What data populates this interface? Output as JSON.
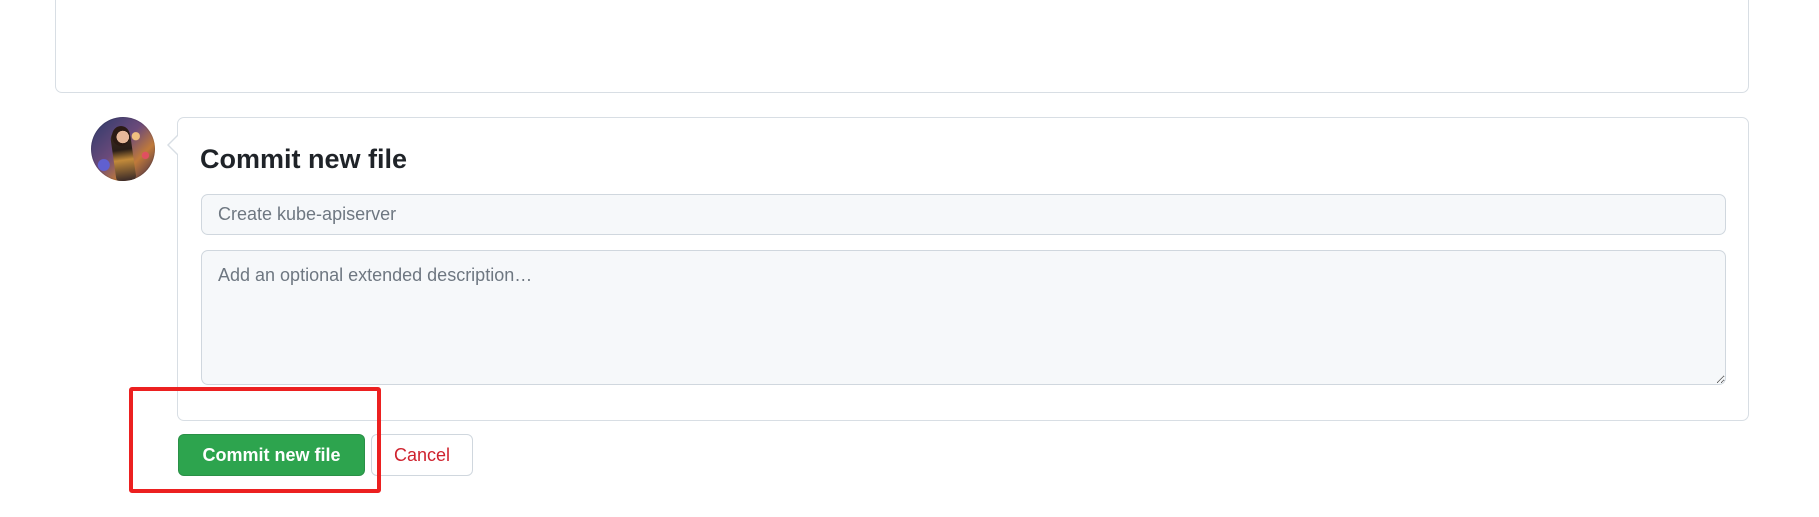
{
  "commit": {
    "title": "Commit new file",
    "summary_placeholder": "Create kube-apiserver",
    "summary_value": "",
    "description_placeholder": "Add an optional extended description…",
    "description_value": ""
  },
  "actions": {
    "commit_label": "Commit new file",
    "cancel_label": "Cancel"
  },
  "icons": {
    "avatar": "user-avatar"
  },
  "colors": {
    "commit_button": "#2da44e",
    "cancel_text": "#cf222e",
    "highlight": "#ec2020",
    "input_bg": "#f6f8fa",
    "border": "#d0d7de"
  }
}
